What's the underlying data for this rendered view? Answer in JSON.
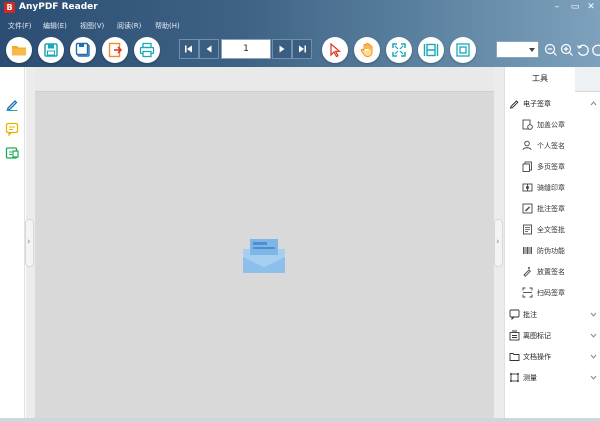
{
  "app": {
    "title": "AnyPDF Reader",
    "logo_glyph": "B"
  },
  "window_controls": {
    "minimize": "–",
    "maximize": "▭",
    "close": "✕"
  },
  "menu": [
    "文件(F)",
    "编辑(E)",
    "视图(V)",
    "阅读(R)",
    "帮助(H)"
  ],
  "toolbar": {
    "file_buttons": [
      "open-folder-icon",
      "save-icon",
      "save-as-icon",
      "export-icon",
      "print-icon"
    ],
    "page_number": "1",
    "mode_buttons": [
      "select-arrow-icon",
      "hand-tool-icon",
      "fit-page-icon",
      "fit-width-icon",
      "full-screen-icon"
    ],
    "zoom_value": "",
    "zoom_tools": [
      "zoom-out-icon",
      "zoom-in-icon",
      "rotate-left-icon",
      "rotate-right-icon"
    ]
  },
  "left_tools": [
    "sign-pen-icon",
    "comment-icon",
    "stamp-icon"
  ],
  "right_panel": {
    "tab_label": "工具",
    "sections": [
      {
        "label": "电子签章",
        "expanded": true,
        "items": [
          "加盖公章",
          "个人签名",
          "多页签章",
          "骑缝印章",
          "批注签章",
          "全文签批",
          "防伪功能",
          "放置签名",
          "扫码签章"
        ]
      },
      {
        "label": "批注",
        "expanded": false,
        "items": []
      },
      {
        "label": "离图标记",
        "expanded": false,
        "items": []
      },
      {
        "label": "文档操作",
        "expanded": false,
        "items": []
      },
      {
        "label": "测量",
        "expanded": false,
        "items": []
      }
    ]
  },
  "colors": {
    "accent_orange": "#f28c28",
    "accent_teal": "#1aa8b8",
    "accent_red": "#e0301e",
    "header_dark": "#2b4d73"
  }
}
